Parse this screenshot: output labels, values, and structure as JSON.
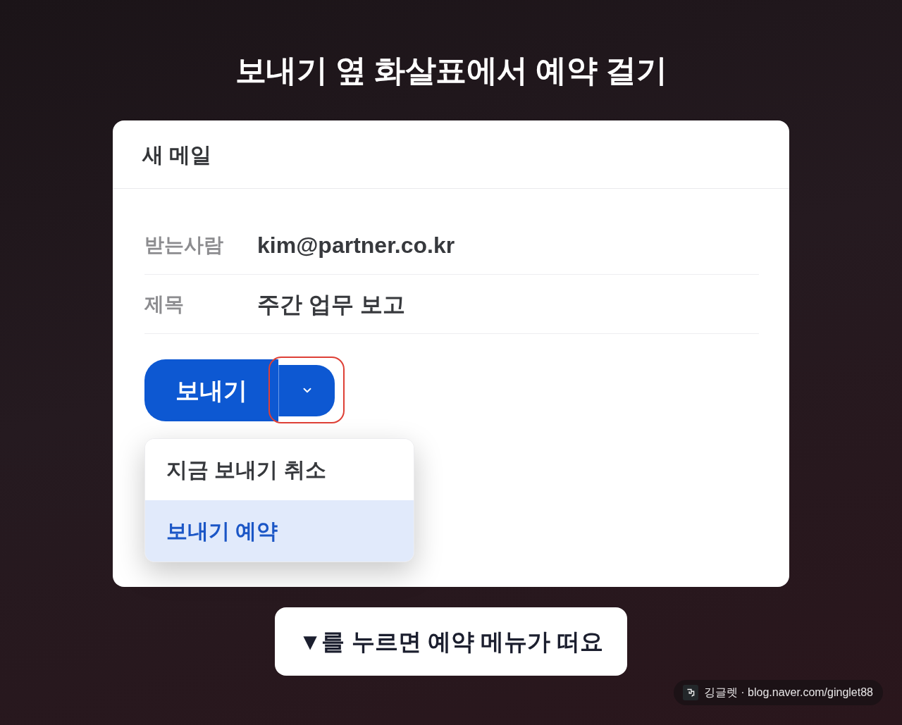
{
  "title": "보내기 옆 화살표에서 예약 걸기",
  "window": {
    "title": "새 메일"
  },
  "fields": [
    {
      "label": "받는사람",
      "value": "kim@partner.co.kr"
    },
    {
      "label": "제목",
      "value": "주간 업무 보고"
    }
  ],
  "send_button": {
    "label": "보내기"
  },
  "dropdown_toggle": {
    "highlighted": true
  },
  "menu": {
    "items": [
      {
        "label": "지금 보내기 취소",
        "selected": false
      },
      {
        "label": "보내기 예약",
        "selected": true
      }
    ]
  },
  "caption": "▼를 누르면 예약 메뉴가 떠요",
  "credit": {
    "text": "깅글렛 · blog.naver.com/ginglet88"
  }
}
